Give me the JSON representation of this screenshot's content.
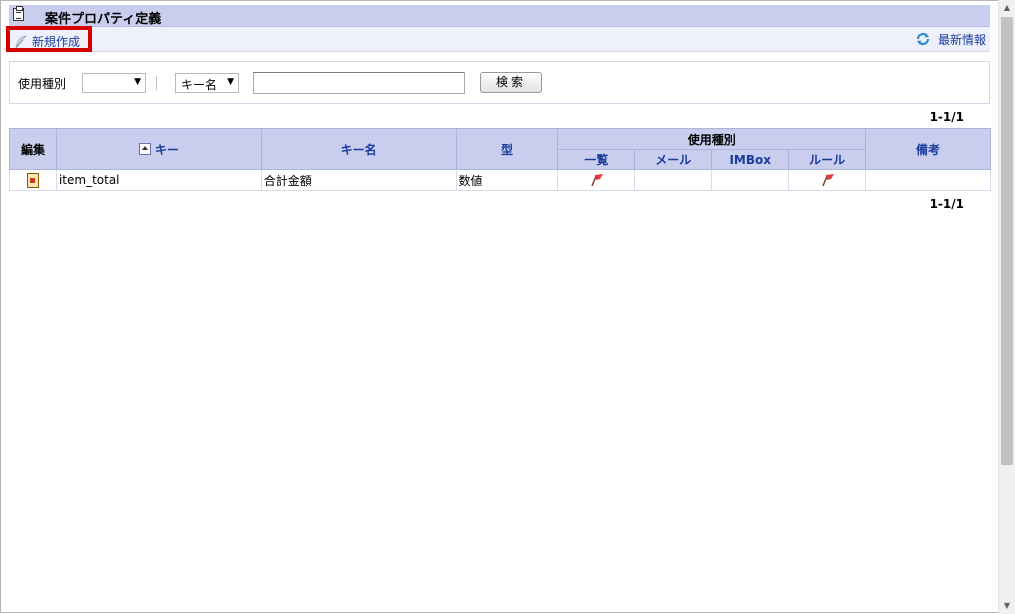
{
  "header": {
    "title": "案件プロパティ定義"
  },
  "toolbar": {
    "new_label": "新規作成",
    "refresh_label": "最新情報"
  },
  "search": {
    "usage_label": "使用種別",
    "usage_value": "",
    "field_select_value": "キー名",
    "query": "",
    "button_label": "検索"
  },
  "pager": {
    "top": "1-1/1",
    "bottom": "1-1/1"
  },
  "table": {
    "headers": {
      "edit": "編集",
      "key": "キー",
      "key_name": "キー名",
      "type": "型",
      "usage": "使用種別",
      "usage_list": "一覧",
      "usage_mail": "メール",
      "usage_imbox": "IMBox",
      "usage_rule": "ルール",
      "note": "備考"
    },
    "rows": [
      {
        "key": "item_total",
        "key_name": "合計金額",
        "type": "数値",
        "list": true,
        "mail": false,
        "imbox": false,
        "rule": true,
        "note": ""
      }
    ]
  },
  "colors": {
    "header_bg": "#c9cdee",
    "link": "#1a3c9e",
    "highlight": "#d40000"
  },
  "icons": [
    "clipboard-icon",
    "feather-icon",
    "refresh-icon",
    "sort-ascending-icon",
    "edit-icon",
    "flag-icon"
  ]
}
